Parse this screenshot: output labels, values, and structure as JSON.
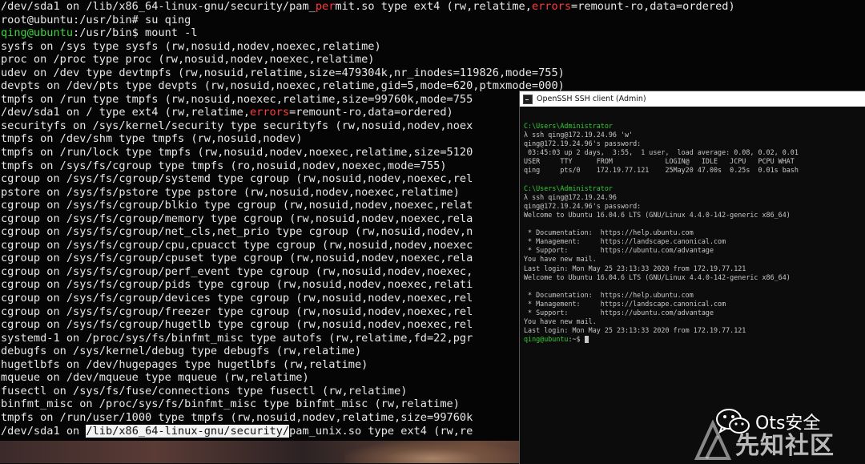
{
  "terminal": {
    "lines": [
      [
        {
          "t": "/dev/sda1 on /lib/x86_64-linux-gnu/security/pam_"
        },
        {
          "t": "per",
          "c": "red"
        },
        {
          "t": "mit.so type ext4 (rw,relatime,"
        },
        {
          "t": "errors",
          "c": "red"
        },
        {
          "t": "=remount-ro,data=ordered)"
        }
      ],
      [
        {
          "t": "root@ubuntu:/usr/bin# su qing"
        }
      ],
      [
        {
          "t": "qing@ubuntu",
          "c": "green"
        },
        {
          "t": ":/usr/bin$ mount -l"
        }
      ],
      [
        {
          "t": "sysfs on /sys type sysfs (rw,nosuid,nodev,noexec,relatime)"
        }
      ],
      [
        {
          "t": "proc on /proc type proc (rw,nosuid,nodev,noexec,relatime)"
        }
      ],
      [
        {
          "t": "udev on /dev type devtmpfs (rw,nosuid,relatime,size=479304k,nr_inodes=119826,mode=755)"
        }
      ],
      [
        {
          "t": "devpts on /dev/pts type devpts (rw,nosuid,noexec,relatime,gid=5,mode=620,ptmxmode=000)"
        }
      ],
      [
        {
          "t": "tmpfs on /run type tmpfs (rw,nosuid,noexec,relatime,size=99760k,mode=755"
        }
      ],
      [
        {
          "t": "/dev/sda1 on / type ext4 (rw,relatime,"
        },
        {
          "t": "errors",
          "c": "red"
        },
        {
          "t": "=remount-ro,data=ordered)"
        }
      ],
      [
        {
          "t": "securityfs on /sys/kernel/security type securityfs (rw,nosuid,nodev,noex"
        }
      ],
      [
        {
          "t": "tmpfs on /dev/shm type tmpfs (rw,nosuid,nodev)"
        }
      ],
      [
        {
          "t": "tmpfs on /run/lock type tmpfs (rw,nosuid,nodev,noexec,relatime,size=5120"
        }
      ],
      [
        {
          "t": "tmpfs on /sys/fs/cgroup type tmpfs (ro,nosuid,nodev,noexec,mode=755)"
        }
      ],
      [
        {
          "t": "cgroup on /sys/fs/cgroup/systemd type cgroup (rw,nosuid,nodev,noexec,rel"
        }
      ],
      [
        {
          "t": "pstore on /sys/fs/pstore type pstore (rw,nosuid,nodev,noexec,relatime)"
        }
      ],
      [
        {
          "t": "cgroup on /sys/fs/cgroup/blkio type cgroup (rw,nosuid,nodev,noexec,relat"
        }
      ],
      [
        {
          "t": "cgroup on /sys/fs/cgroup/memory type cgroup (rw,nosuid,nodev,noexec,rela"
        }
      ],
      [
        {
          "t": "cgroup on /sys/fs/cgroup/net_cls,net_prio type cgroup (rw,nosuid,nodev,n"
        }
      ],
      [
        {
          "t": "cgroup on /sys/fs/cgroup/cpu,cpuacct type cgroup (rw,nosuid,nodev,noexec"
        }
      ],
      [
        {
          "t": "cgroup on /sys/fs/cgroup/cpuset type cgroup (rw,nosuid,nodev,noexec,rela"
        }
      ],
      [
        {
          "t": "cgroup on /sys/fs/cgroup/perf_event type cgroup (rw,nosuid,nodev,noexec,"
        }
      ],
      [
        {
          "t": "cgroup on /sys/fs/cgroup/pids type cgroup (rw,nosuid,nodev,noexec,relati"
        }
      ],
      [
        {
          "t": "cgroup on /sys/fs/cgroup/devices type cgroup (rw,nosuid,nodev,noexec,rel"
        }
      ],
      [
        {
          "t": "cgroup on /sys/fs/cgroup/freezer type cgroup (rw,nosuid,nodev,noexec,rel"
        }
      ],
      [
        {
          "t": "cgroup on /sys/fs/cgroup/hugetlb type cgroup (rw,nosuid,nodev,noexec,rel"
        }
      ],
      [
        {
          "t": "systemd-1 on /proc/sys/fs/binfmt_misc type autofs (rw,relatime,fd=22,pgr"
        }
      ],
      [
        {
          "t": "debugfs on /sys/kernel/debug type debugfs (rw,relatime)"
        }
      ],
      [
        {
          "t": "hugetlbfs on /dev/hugepages type hugetlbfs (rw,relatime)"
        }
      ],
      [
        {
          "t": "mqueue on /dev/mqueue type mqueue (rw,relatime)"
        }
      ],
      [
        {
          "t": "fusectl on /sys/fs/fuse/connections type fusectl (rw,relatime)"
        }
      ],
      [
        {
          "t": "binfmt_misc on /proc/sys/fs/binfmt_misc type binfmt_misc (rw,relatime)"
        }
      ],
      [
        {
          "t": "tmpfs on /run/user/1000 type tmpfs (rw,nosuid,nodev,relatime,size=99760k"
        }
      ],
      [
        {
          "t": "/dev/sda1 on "
        },
        {
          "t": "/lib/x86_64-linux-gnu/security/",
          "c": "hl"
        },
        {
          "t": "pam_unix.so type ext4 (rw,re"
        }
      ]
    ]
  },
  "ssh_window": {
    "title": "OpenSSH SSH client (Admin)",
    "lines": [
      [
        {
          "t": "C:\\Users\\Administrator",
          "c": "wgreen"
        }
      ],
      [
        {
          "t": "λ ssh qing@172.19.24.96 'w'"
        }
      ],
      [
        {
          "t": "qing@172.19.24.96's password:"
        }
      ],
      [
        {
          "t": " 03:45:03 up 2 days,  3:55,  1 user,  load average: 0.08, 0.02, 0.01"
        }
      ],
      [
        {
          "t": "USER     TTY      FROM             LOGIN@   IDLE   JCPU   PCPU WHAT"
        }
      ],
      [
        {
          "t": "qing     pts/0    172.19.77.121    25May20 47.00s  0.25s  0.01s bash"
        }
      ],
      [
        {
          "t": ""
        }
      ],
      [
        {
          "t": "C:\\Users\\Administrator",
          "c": "wgreen"
        }
      ],
      [
        {
          "t": "λ ssh qing@172.19.24.96"
        }
      ],
      [
        {
          "t": "qing@172.19.24.96's password:"
        }
      ],
      [
        {
          "t": "Welcome to Ubuntu 16.04.6 LTS (GNU/Linux 4.4.0-142-generic x86_64)"
        }
      ],
      [
        {
          "t": ""
        }
      ],
      [
        {
          "t": " * Documentation:  https://help.ubuntu.com"
        }
      ],
      [
        {
          "t": " * Management:     https://landscape.canonical.com"
        }
      ],
      [
        {
          "t": " * Support:        https://ubuntu.com/advantage"
        }
      ],
      [
        {
          "t": "You have new mail."
        }
      ],
      [
        {
          "t": "Last login: Mon May 25 23:13:33 2020 from 172.19.77.121"
        }
      ],
      [
        {
          "t": "Welcome to Ubuntu 16.04.6 LTS (GNU/Linux 4.4.0-142-generic x86_64)"
        }
      ],
      [
        {
          "t": ""
        }
      ],
      [
        {
          "t": " * Documentation:  https://help.ubuntu.com"
        }
      ],
      [
        {
          "t": " * Management:     https://landscape.canonical.com"
        }
      ],
      [
        {
          "t": " * Support:        https://ubuntu.com/advantage"
        }
      ],
      [
        {
          "t": "You have new mail."
        }
      ],
      [
        {
          "t": "Last login: Mon May 25 23:13:33 2020 from 172.19.77.121"
        }
      ],
      [
        {
          "t": "qing@ubuntu",
          "c": "wgreen"
        },
        {
          "t": ":~$ "
        }
      ]
    ]
  },
  "watermark": {
    "ots_text": "Ots安全",
    "xz_text": "先知社区"
  }
}
